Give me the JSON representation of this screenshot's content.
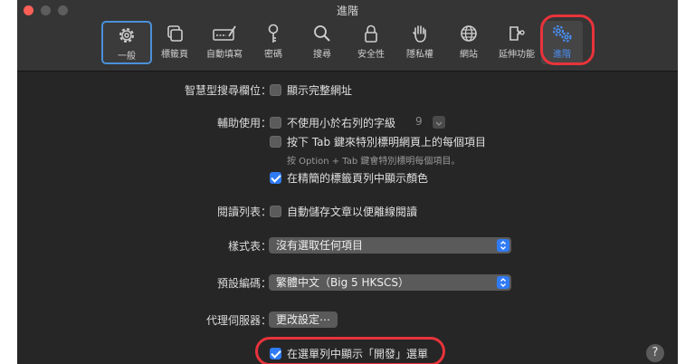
{
  "window": {
    "title": "進階"
  },
  "toolbar": [
    {
      "label": "一般",
      "icon": "gear-icon"
    },
    {
      "label": "標籤頁",
      "icon": "tabs-icon"
    },
    {
      "label": "自動填寫",
      "icon": "autofill-icon"
    },
    {
      "label": "密碼",
      "icon": "key-icon"
    },
    {
      "label": "搜尋",
      "icon": "search-icon"
    },
    {
      "label": "安全性",
      "icon": "lock-icon"
    },
    {
      "label": "隱私權",
      "icon": "hand-icon"
    },
    {
      "label": "網站",
      "icon": "globe-icon"
    },
    {
      "label": "延伸功能",
      "icon": "puzzle-icon"
    },
    {
      "label": "進階",
      "icon": "gears-icon"
    }
  ],
  "settings": {
    "smart_search": {
      "label": "智慧型搜尋欄位：",
      "option": "顯示完整網址",
      "checked": false
    },
    "accessibility": {
      "label": "輔助使用：",
      "min_font": {
        "text": "不使用小於右列的字級",
        "checked": false,
        "value": "9"
      },
      "tab_highlight": {
        "text": "按下 Tab 鍵來特別標明網頁上的每個項目",
        "checked": false
      },
      "hint": "按 Option + Tab 鍵會特別標明每個項目。",
      "color_compact": {
        "text": "在精簡的標籤頁列中顯示顏色",
        "checked": true
      }
    },
    "reading_list": {
      "label": "閱讀列表：",
      "option": "自動儲存文章以便離線閱讀",
      "checked": false
    },
    "stylesheet": {
      "label": "樣式表：",
      "value": "沒有選取任何項目"
    },
    "encoding": {
      "label": "預設編碼：",
      "value": "繁體中文（Big 5 HKSCS）"
    },
    "proxy": {
      "label": "代理伺服器：",
      "button": "更改設定⋯"
    },
    "develop_menu": {
      "text": "在選單列中顯示「開發」選單",
      "checked": true
    }
  },
  "help": {
    "label": "?"
  },
  "colors": {
    "accent": "#2f7bf5",
    "highlight": "#e8333b",
    "background": "#262626"
  }
}
